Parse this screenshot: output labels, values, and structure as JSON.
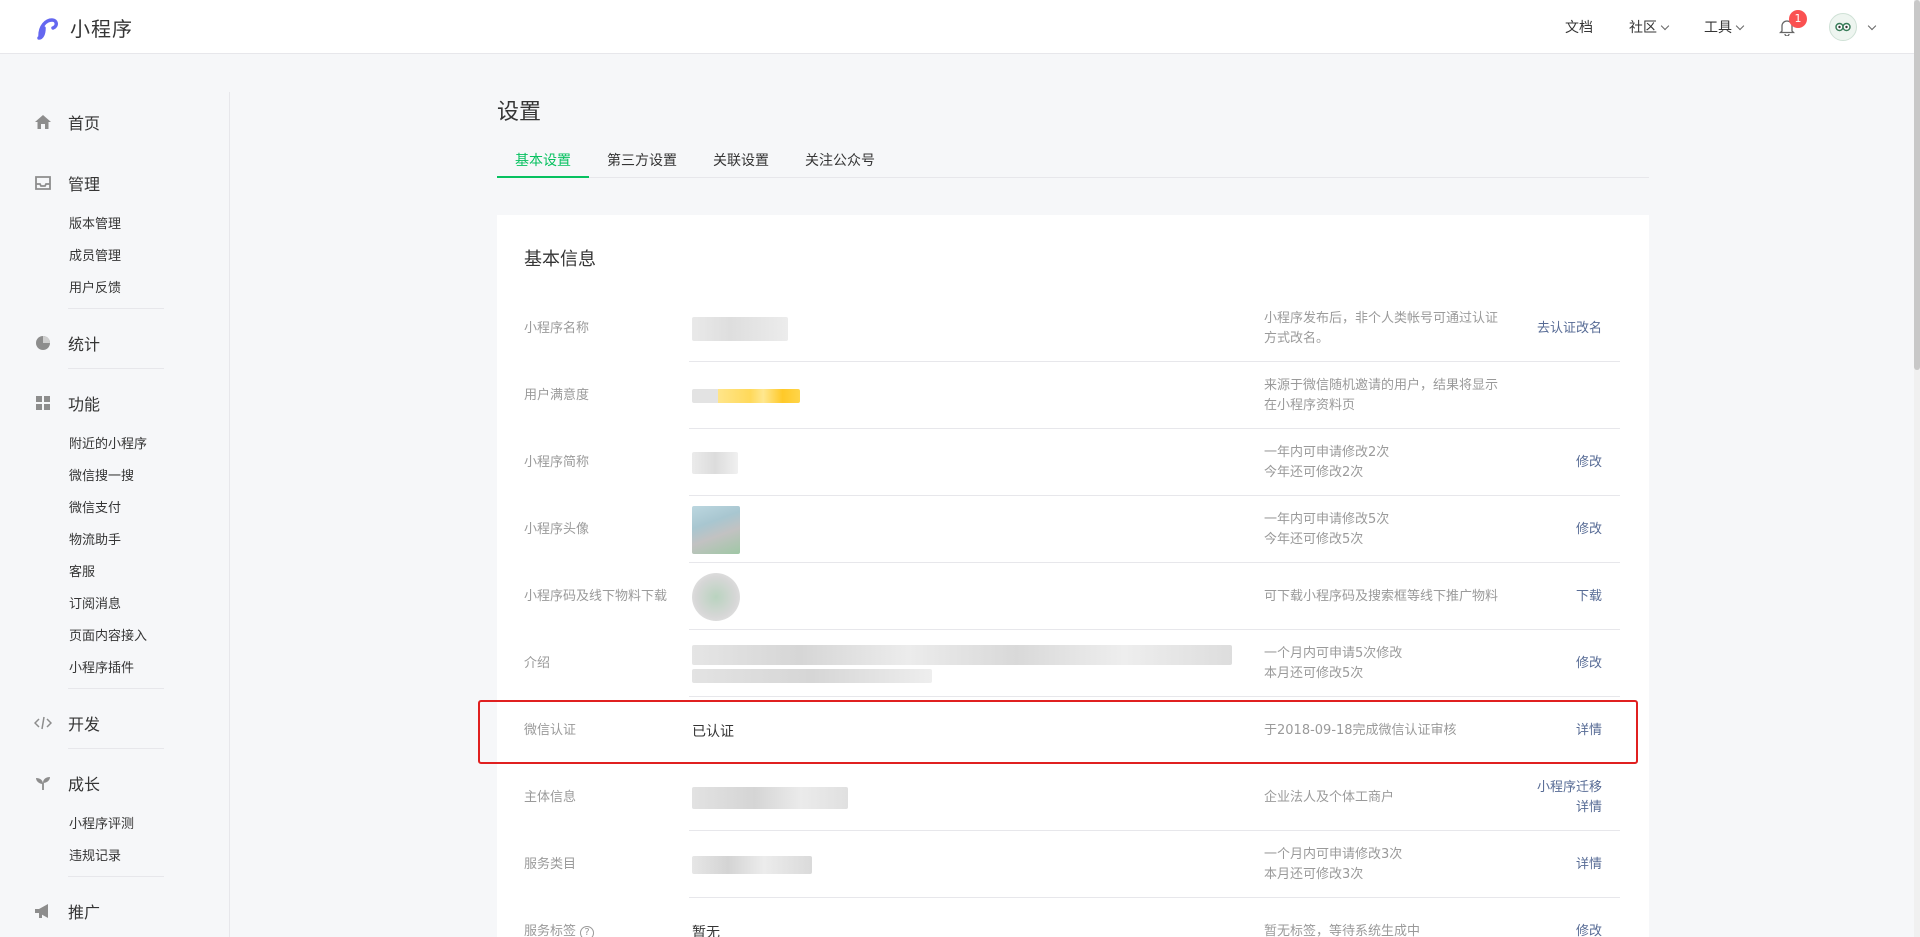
{
  "header": {
    "logo_text": "小程序",
    "nav": {
      "docs": "文档",
      "community": "社区",
      "tools": "工具"
    },
    "notification_count": "1"
  },
  "sidebar": {
    "home": "首页",
    "manage": {
      "label": "管理",
      "items": [
        "版本管理",
        "成员管理",
        "用户反馈"
      ]
    },
    "stats": "统计",
    "features": {
      "label": "功能",
      "items": [
        "附近的小程序",
        "微信搜一搜",
        "微信支付",
        "物流助手",
        "客服",
        "订阅消息",
        "页面内容接入",
        "小程序插件"
      ]
    },
    "dev": "开发",
    "growth": {
      "label": "成长",
      "items": [
        "小程序评测",
        "违规记录"
      ]
    },
    "promote": "推广"
  },
  "main": {
    "title": "设置",
    "tabs": [
      "基本设置",
      "第三方设置",
      "关联设置",
      "关注公众号"
    ],
    "section_title": "基本信息",
    "rows": [
      {
        "label": "小程序名称",
        "desc": [
          "小程序发布后，非个人类帐号可通过认证",
          "方式改名。"
        ],
        "action": [
          "去认证改名"
        ]
      },
      {
        "label": "用户满意度",
        "desc": [
          "来源于微信随机邀请的用户，结果将显示",
          "在小程序资料页"
        ],
        "action": []
      },
      {
        "label": "小程序简称",
        "desc": [
          "一年内可申请修改2次",
          "今年还可修改2次"
        ],
        "action": [
          "修改"
        ]
      },
      {
        "label": "小程序头像",
        "desc": [
          "一年内可申请修改5次",
          "今年还可修改5次"
        ],
        "action": [
          "修改"
        ]
      },
      {
        "label": "小程序码及线下物料下载",
        "desc": [
          "可下载小程序码及搜索框等线下推广物料"
        ],
        "action": [
          "下载"
        ]
      },
      {
        "label": "介绍",
        "desc": [
          "一个月内可申请5次修改",
          "本月还可修改5次"
        ],
        "action": [
          "修改"
        ]
      },
      {
        "label": "微信认证",
        "value": "已认证",
        "desc": [
          "于2018-09-18完成微信认证审核"
        ],
        "action": [
          "详情"
        ]
      },
      {
        "label": "主体信息",
        "desc": [
          "企业法人及个体工商户"
        ],
        "action": [
          "小程序迁移",
          "详情"
        ]
      },
      {
        "label": "服务类目",
        "desc": [
          "一个月内可申请修改3次",
          "本月还可修改3次"
        ],
        "action": [
          "详情"
        ]
      },
      {
        "label": "服务标签",
        "value": "暂无",
        "desc": [
          "暂无标签，等待系统生成中"
        ],
        "action": [
          "修改"
        ]
      }
    ]
  },
  "colors": {
    "accent": "#07c160",
    "link": "#576b95",
    "highlight": "#e02020",
    "badge": "#fa5151"
  }
}
